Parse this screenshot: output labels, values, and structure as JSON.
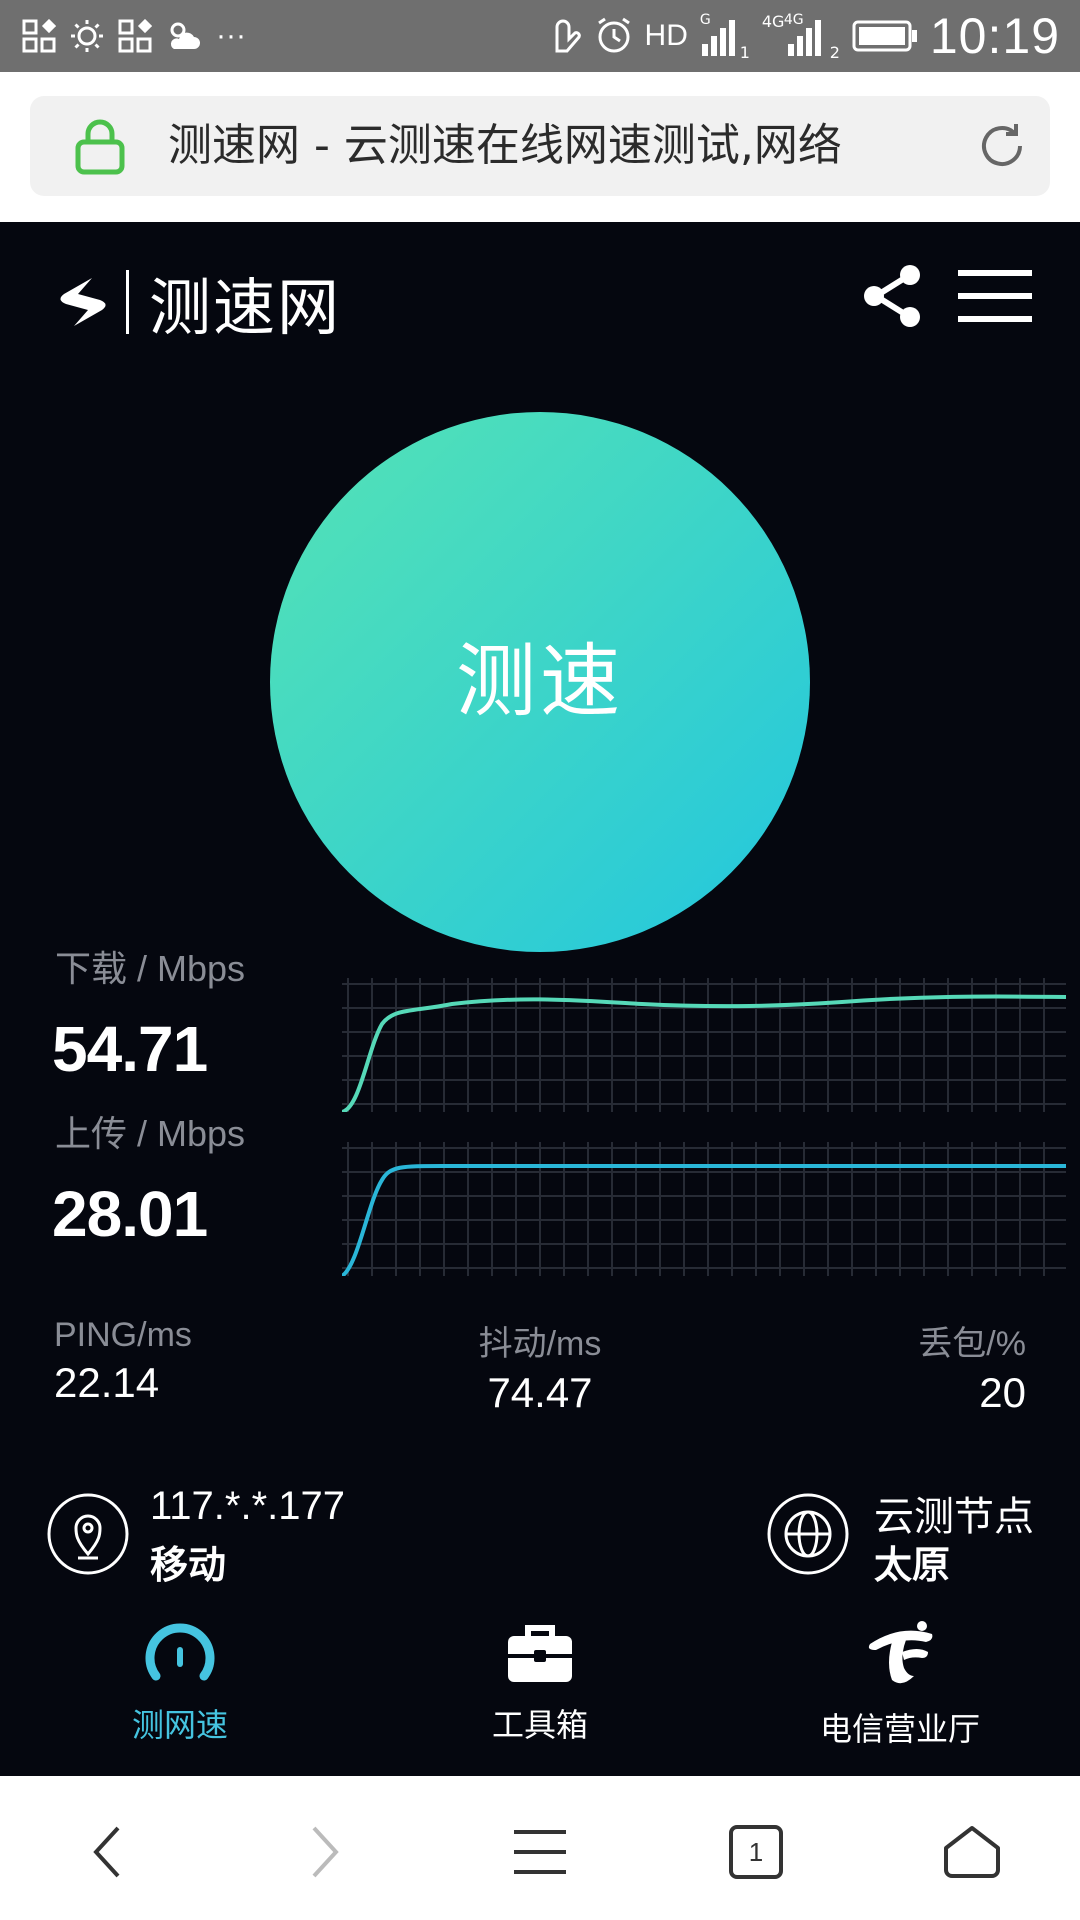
{
  "status_bar": {
    "hd": "HD",
    "sim1_label": "G",
    "sim2_label": "4G",
    "sim2_sub": "4G",
    "sim1_index": "1",
    "sim2_index": "2",
    "more": "···",
    "time": "10:19"
  },
  "address_bar": {
    "title": "测速网 - 云测速在线网速测试,网络",
    "lock_color": "#4cc14c"
  },
  "header": {
    "logo_text": "测速网"
  },
  "speed_button": {
    "label": "测速",
    "gradient_start": "#55e3b5",
    "gradient_end": "#22c6df"
  },
  "download": {
    "label": "下载 / Mbps",
    "value": "54.71",
    "line_color": "#56d9b8"
  },
  "upload": {
    "label": "上传 / Mbps",
    "value": "28.01",
    "line_color": "#2ab6d8"
  },
  "stats": {
    "ping_label": "PING/ms",
    "ping_value": "22.14",
    "jitter_label": "抖动/ms",
    "jitter_value": "74.47",
    "loss_label": "丢包/%",
    "loss_value": "20"
  },
  "client": {
    "ip": "117.*.*.177",
    "isp": "移动"
  },
  "server": {
    "label": "云测节点",
    "city": "太原"
  },
  "nav": {
    "items": [
      {
        "label": "测网速",
        "icon": "gauge-icon"
      },
      {
        "label": "工具箱",
        "icon": "toolbox-icon"
      },
      {
        "label": "电信营业厅",
        "icon": "telecom-logo-icon"
      }
    ],
    "active_color": "#45c4e0"
  },
  "browser_bar": {
    "tab_count": "1"
  }
}
